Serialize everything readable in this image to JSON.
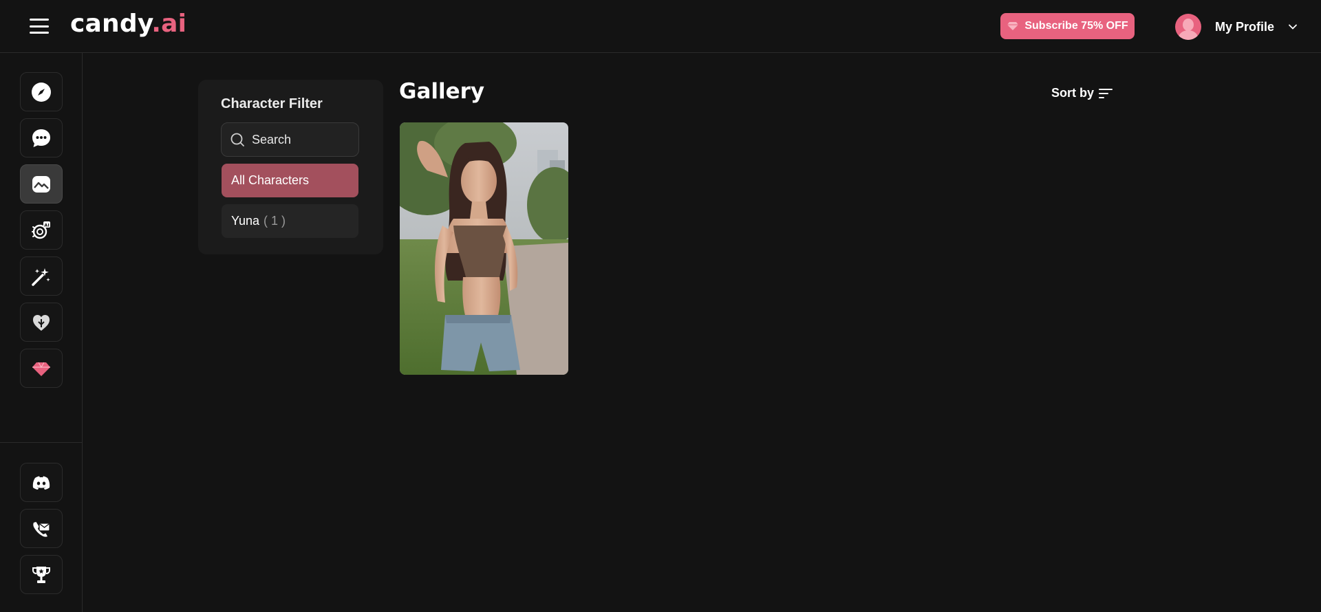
{
  "header": {
    "logo_main": "candy",
    "logo_accent": ".ai",
    "subscribe_label": "Subscribe 75% OFF",
    "profile_label": "My Profile"
  },
  "sidebar": {
    "items": [
      {
        "icon": "compass-icon",
        "active": false
      },
      {
        "icon": "chat-icon",
        "active": false
      },
      {
        "icon": "gallery-icon",
        "active": true
      },
      {
        "icon": "ai-character-icon",
        "active": false
      },
      {
        "icon": "magic-wand-icon",
        "active": false
      },
      {
        "icon": "heart-icon",
        "active": false
      },
      {
        "icon": "premium-diamond-icon",
        "active": false
      }
    ],
    "bottom_items": [
      {
        "icon": "discord-icon"
      },
      {
        "icon": "contact-mail-icon"
      },
      {
        "icon": "trophy-icon"
      }
    ]
  },
  "filter": {
    "title": "Character Filter",
    "search_placeholder": "Search",
    "items": [
      {
        "label": "All Characters",
        "count": "",
        "selected": true
      },
      {
        "label": "Yuna",
        "count": "( 1 )",
        "selected": false
      }
    ]
  },
  "gallery": {
    "title": "Gallery",
    "sort_label": "Sort by",
    "images": [
      {
        "alt": "Yuna"
      }
    ]
  },
  "colors": {
    "accent": "#e8627f",
    "selected_filter": "#a3505d",
    "background": "#131313",
    "panel": "#1b1b1b"
  }
}
